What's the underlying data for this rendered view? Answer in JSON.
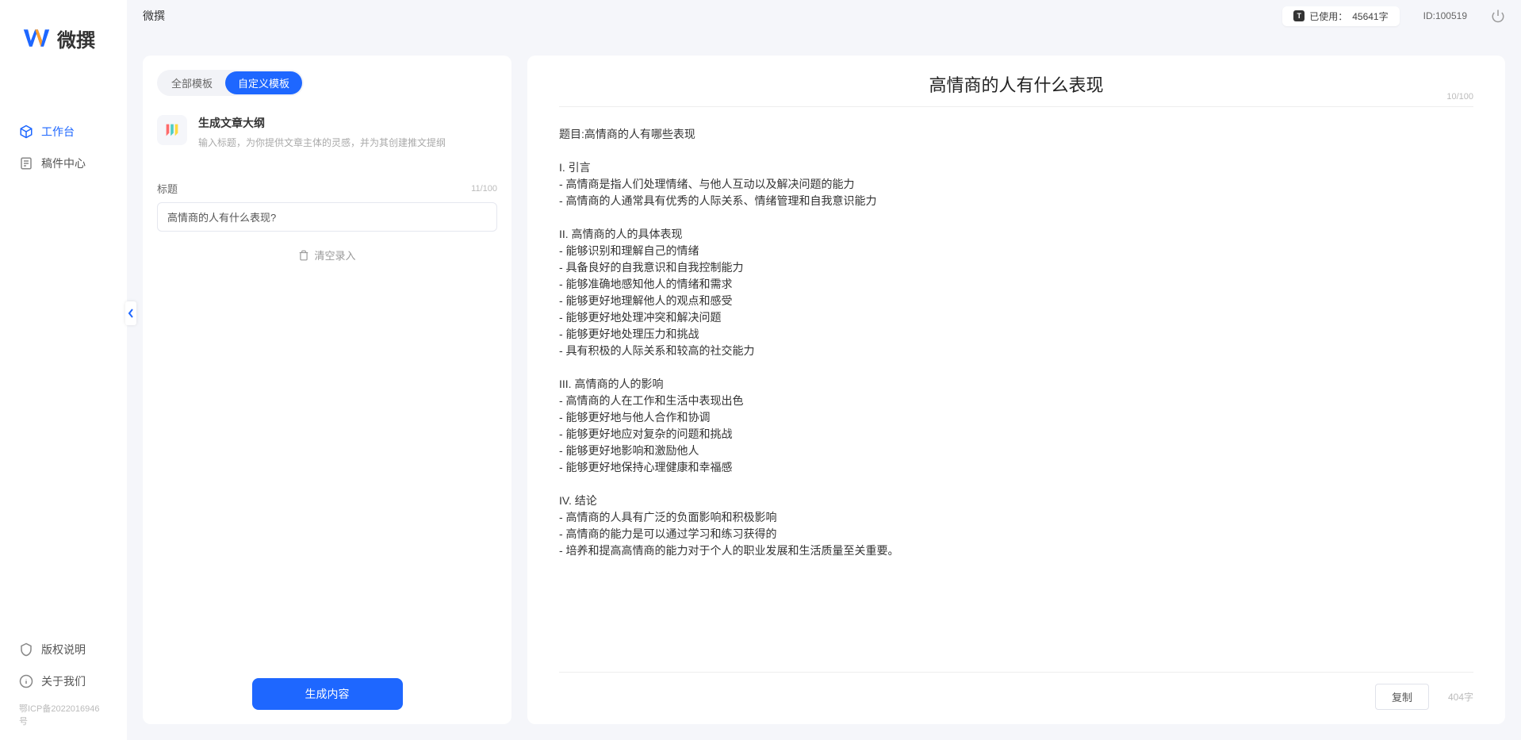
{
  "app": {
    "name": "微撰",
    "logo_text": "微撰"
  },
  "sidebar": {
    "items": [
      {
        "label": "工作台",
        "active": true,
        "icon": "cube"
      },
      {
        "label": "稿件中心",
        "active": false,
        "icon": "document"
      }
    ],
    "bottom": [
      {
        "label": "版权说明",
        "icon": "shield"
      },
      {
        "label": "关于我们",
        "icon": "info"
      }
    ],
    "icp": "鄂ICP备2022016946号"
  },
  "header": {
    "title": "微撰",
    "usage_label": "已使用：",
    "usage_value": "45641字",
    "user_id_label": "ID:",
    "user_id": "100519"
  },
  "left_panel": {
    "tabs": [
      {
        "label": "全部模板",
        "active": false
      },
      {
        "label": "自定义模板",
        "active": true
      }
    ],
    "template": {
      "title": "生成文章大纲",
      "desc": "输入标题，为你提供文章主体的灵感，并为其创建推文提纲"
    },
    "form": {
      "title_label": "标题",
      "title_count": "11/100",
      "title_value": "高情商的人有什么表现?",
      "clear_label": "清空录入"
    },
    "generate_btn": "生成内容"
  },
  "output": {
    "title": "高情商的人有什么表现",
    "meta": "10/100",
    "body": "题目:高情商的人有哪些表现\n\nI. 引言\n- 高情商是指人们处理情绪、与他人互动以及解决问题的能力\n- 高情商的人通常具有优秀的人际关系、情绪管理和自我意识能力\n\nII. 高情商的人的具体表现\n- 能够识别和理解自己的情绪\n- 具备良好的自我意识和自我控制能力\n- 能够准确地感知他人的情绪和需求\n- 能够更好地理解他人的观点和感受\n- 能够更好地处理冲突和解决问题\n- 能够更好地处理压力和挑战\n- 具有积极的人际关系和较高的社交能力\n\nIII. 高情商的人的影响\n- 高情商的人在工作和生活中表现出色\n- 能够更好地与他人合作和协调\n- 能够更好地应对复杂的问题和挑战\n- 能够更好地影响和激励他人\n- 能够更好地保持心理健康和幸福感\n\nIV. 结论\n- 高情商的人具有广泛的负面影响和积极影响\n- 高情商的能力是可以通过学习和练习获得的\n- 培养和提高高情商的能力对于个人的职业发展和生活质量至关重要。",
    "copy_btn": "复制",
    "word_count": "404字"
  }
}
